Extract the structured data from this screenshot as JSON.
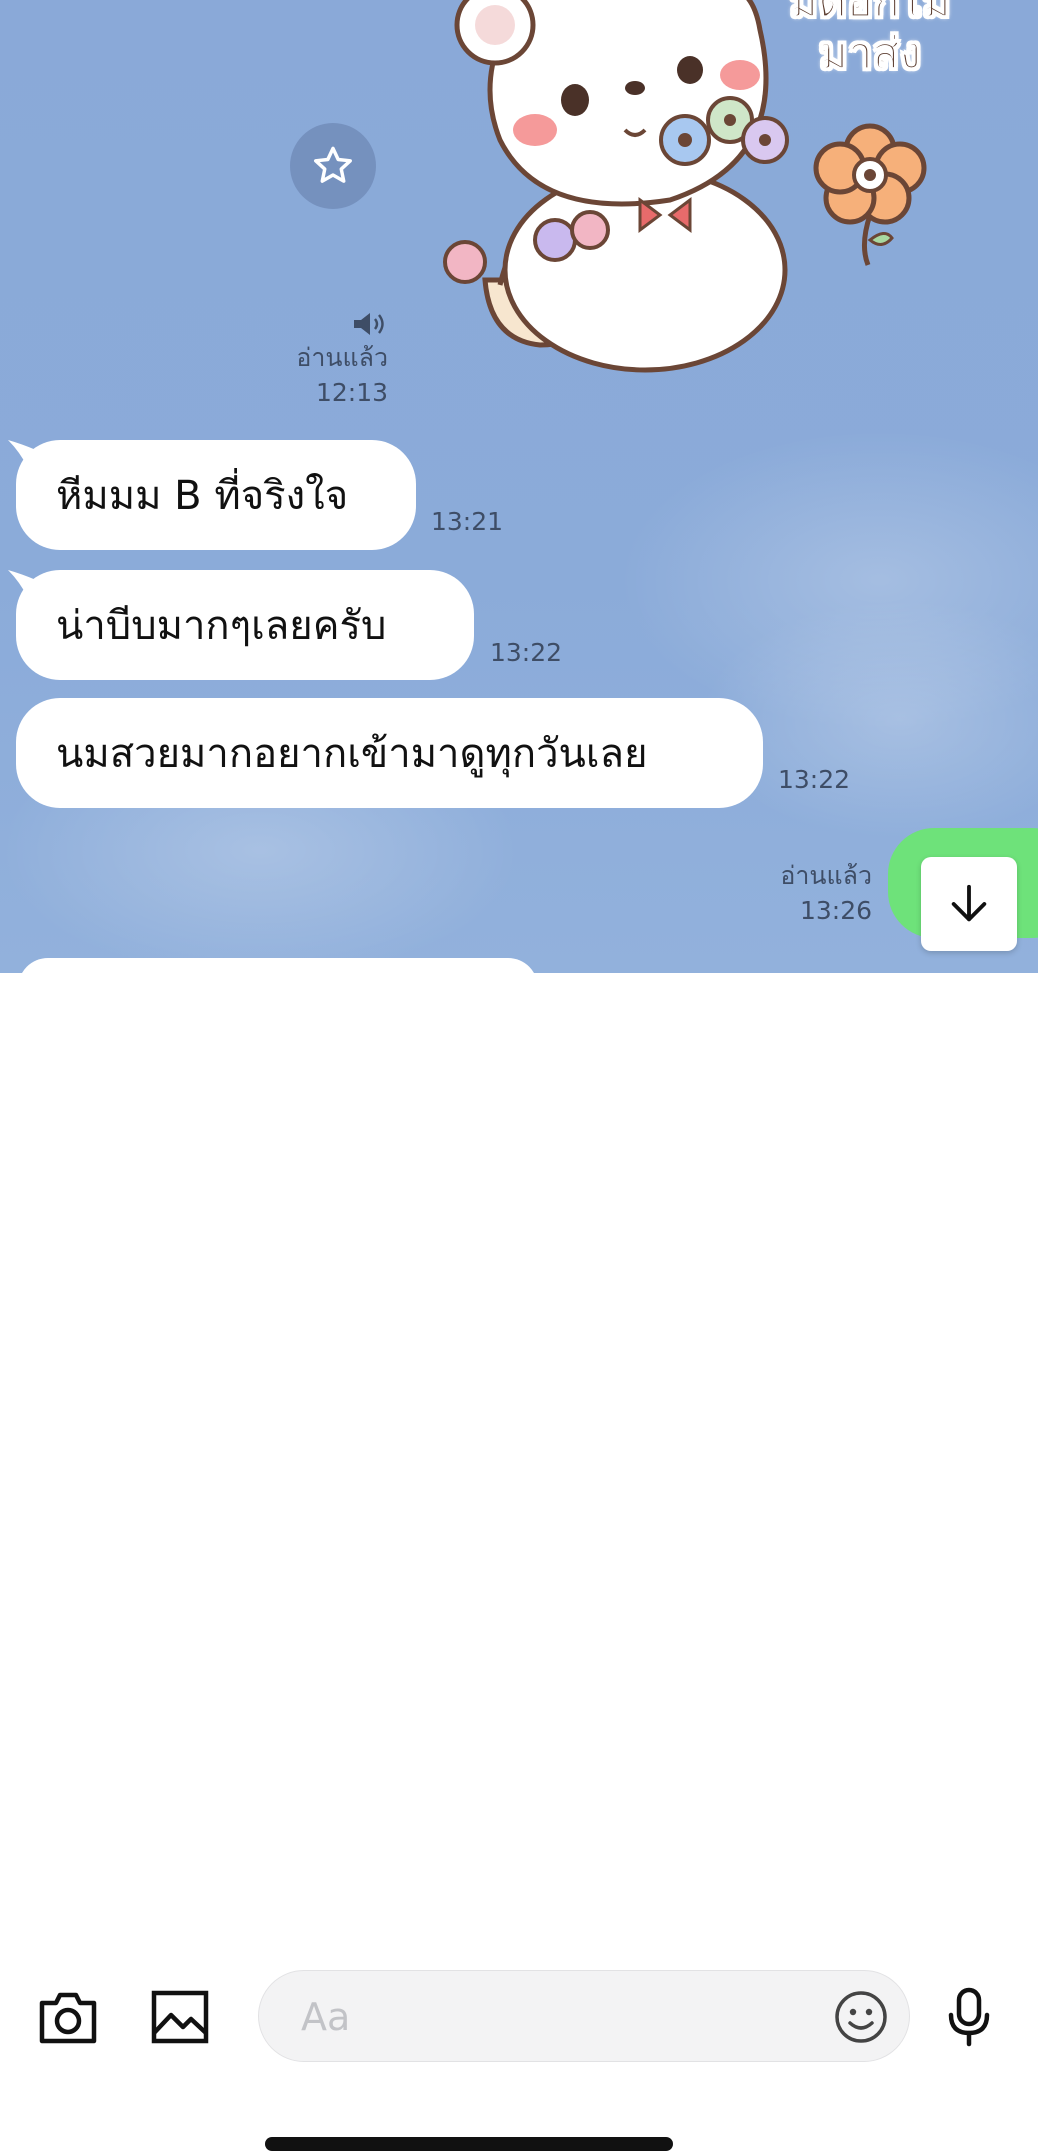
{
  "sticker": {
    "caption_line1": "มีดอกไม้",
    "caption_line2": "มาส่ง"
  },
  "sent_sticker_meta": {
    "read_label": "อ่านแล้ว",
    "time": "12:13"
  },
  "messages": [
    {
      "text": "หีมมม B ที่จริงใจ",
      "time": "13:21"
    },
    {
      "text": "น่าบีบมากๆเลยครับ",
      "time": "13:22"
    },
    {
      "text": "นมสวยมากอยากเข้ามาดูทุกวันเลย",
      "time": "13:22"
    }
  ],
  "sent_message_meta": {
    "read_label": "อ่านแล้ว",
    "time": "13:26"
  },
  "composer": {
    "placeholder": "Aa"
  },
  "icons": {
    "star": "star-icon",
    "speaker": "speaker-icon",
    "scroll_down": "arrow-down-icon",
    "camera": "camera-icon",
    "image": "image-icon",
    "emoji": "emoji-icon",
    "mic": "microphone-icon"
  },
  "colors": {
    "chat_background": "#8aa9d8",
    "sent_bubble": "#6ee27a",
    "received_bubble": "#ffffff"
  }
}
